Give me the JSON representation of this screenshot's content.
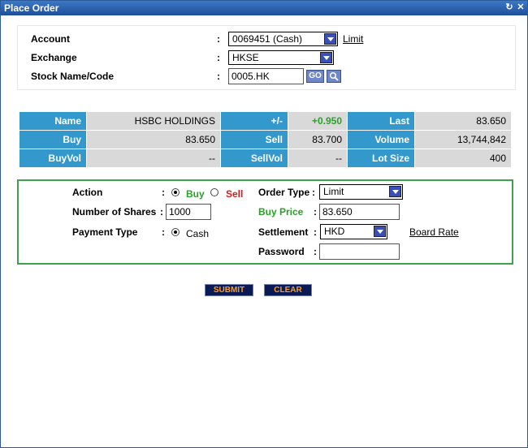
{
  "window": {
    "title": "Place Order",
    "icons": [
      "refresh-icon",
      "close-icon"
    ]
  },
  "account_section": {
    "account_label": "Account",
    "account_value": "0069451 (Cash)",
    "limit_link": "Limit",
    "exchange_label": "Exchange",
    "exchange_value": "HKSE",
    "stock_label": "Stock Name/Code",
    "stock_value": "0005.HK",
    "go_label": "GO",
    "colon": ":"
  },
  "quote": {
    "name_label": "Name",
    "name_value": "HSBC HOLDINGS",
    "change_label": "+/-",
    "change_value": "+0.950",
    "last_label": "Last",
    "last_value": "83.650",
    "buy_label": "Buy",
    "buy_value": "83.650",
    "sell_label": "Sell",
    "sell_value": "83.700",
    "volume_label": "Volume",
    "volume_value": "13,744,842",
    "buyvol_label": "BuyVol",
    "buyvol_value": "--",
    "sellvol_label": "SellVol",
    "sellvol_value": "--",
    "lotsize_label": "Lot Size",
    "lotsize_value": "400",
    "colors": {
      "header_bg": "#3399cc",
      "value_bg": "#d9d9d9",
      "positive": "#2ca02c"
    }
  },
  "order": {
    "action_label": "Action",
    "buy_option": "Buy",
    "sell_option": "Sell",
    "action_selected": "Buy",
    "shares_label": "Number of Shares",
    "shares_value": "1000",
    "payment_label": "Payment Type",
    "payment_option": "Cash",
    "order_type_label": "Order Type",
    "order_type_value": "Limit",
    "buy_price_label": "Buy Price",
    "buy_price_value": "83.650",
    "settlement_label": "Settlement",
    "settlement_value": "HKD",
    "board_rate_link": "Board Rate",
    "password_label": "Password",
    "password_value": "",
    "colon": ":"
  },
  "buttons": {
    "submit": "SUBMIT",
    "clear": "CLEAR"
  }
}
